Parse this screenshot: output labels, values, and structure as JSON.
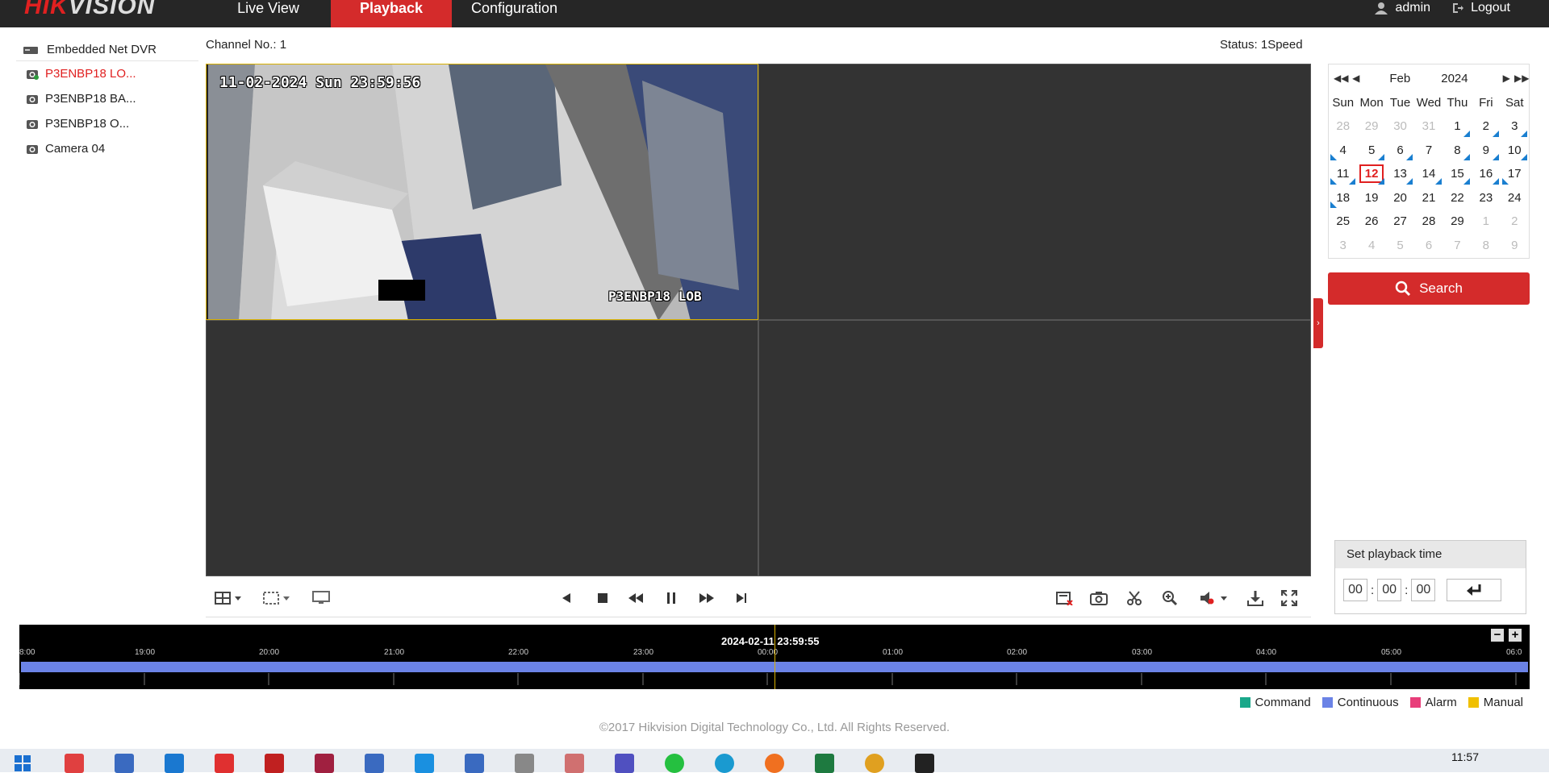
{
  "app": {
    "logo_hi": "HIK",
    "logo_rest": "VISION",
    "nav_tabs": [
      {
        "label": "Live View"
      },
      {
        "label": "Playback"
      },
      {
        "label": "Configuration"
      }
    ],
    "user": "admin",
    "logout": "Logout"
  },
  "tree": {
    "root": "Embedded Net DVR",
    "items": [
      {
        "label": "P3ENBP18 LO..."
      },
      {
        "label": "P3ENBP18 BA..."
      },
      {
        "label": "P3ENBP18 O..."
      },
      {
        "label": "Camera 04"
      }
    ]
  },
  "video": {
    "channel_label": "Channel No.: 1",
    "status_label": "Status: 1Speed",
    "osd_time": "11-02-2024 Sun 23:59:56",
    "osd_name": "P3ENBP18 LOB"
  },
  "calendar": {
    "month": "Feb",
    "year": "2024",
    "dow": [
      "Sun",
      "Mon",
      "Tue",
      "Wed",
      "Thu",
      "Fri",
      "Sat"
    ],
    "days": [
      "28",
      "29",
      "30",
      "31",
      "1",
      "2",
      "3",
      "4",
      "5",
      "6",
      "7",
      "8",
      "9",
      "10",
      "11",
      "12",
      "13",
      "14",
      "15",
      "16",
      "17",
      "18",
      "19",
      "20",
      "21",
      "22",
      "23",
      "24",
      "25",
      "26",
      "27",
      "28",
      "29",
      "1",
      "2",
      "3",
      "4",
      "5",
      "6",
      "7",
      "8",
      "9"
    ],
    "selected": "12"
  },
  "search_label": "Search",
  "playback_time": {
    "title": "Set playback time",
    "hh": "00",
    "mm": "00",
    "ss": "00",
    "sep": ":"
  },
  "timeline": {
    "current": "2024-02-11 23:59:55",
    "hours": [
      "8:00",
      "19:00",
      "20:00",
      "21:00",
      "22:00",
      "23:00",
      "00:00",
      "01:00",
      "02:00",
      "03:00",
      "04:00",
      "05:00",
      "06:0"
    ]
  },
  "legend": [
    {
      "label": "Command",
      "color": "#1aa88a"
    },
    {
      "label": "Continuous",
      "color": "#6b83e6"
    },
    {
      "label": "Alarm",
      "color": "#e83e7a"
    },
    {
      "label": "Manual",
      "color": "#f0c000"
    }
  ],
  "footer": "©2017 Hikvision Digital Technology Co., Ltd. All Rights Reserved.",
  "taskbar": {
    "time": "11:57"
  },
  "colors": {
    "accent": "#d42b2b",
    "topbar": "#262626",
    "record": "#6b83e6"
  }
}
